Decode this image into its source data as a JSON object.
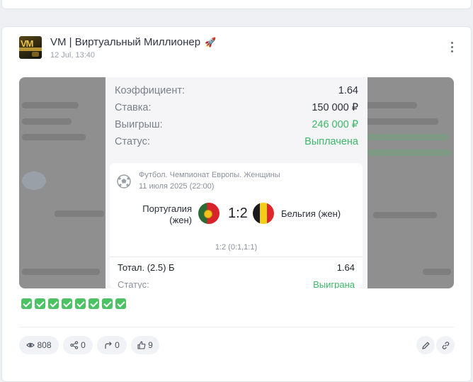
{
  "channel": {
    "name": "VM | Виртуальный Миллионер",
    "emoji": "🚀",
    "time": "12 Jul, 13:40"
  },
  "receipt": {
    "rows": [
      {
        "label": "Коэффициент:",
        "value": "1.64"
      },
      {
        "label": "Ставка:",
        "value": "150 000 ₽"
      },
      {
        "label": "Выигрыш:",
        "value": "246 000 ₽"
      },
      {
        "label": "Статус:",
        "value": "Выплачена"
      }
    ],
    "event": {
      "league": "Футбол. Чемпионат Европы. Женщины",
      "date": "11 июля 2025 (22:00)",
      "team_home": "Португалия (жен)",
      "score": "1:2",
      "team_away": "Бельгия (жен)",
      "half_scores": "1:2 (0:1,1:1)",
      "bet_label": "Тотал. (2.5) Б",
      "bet_coef": "1.64",
      "status_label": "Статус:",
      "status_value": "Выиграна"
    }
  },
  "checkmarks": [
    "✅",
    "✅",
    "✅",
    "✅",
    "✅",
    "✅",
    "✅",
    "✅"
  ],
  "stats": {
    "views": "808",
    "shares": "0",
    "forwards": "0",
    "likes": "9"
  },
  "colors": {
    "success": "#3cb868",
    "check_bg": "#4cc264"
  }
}
